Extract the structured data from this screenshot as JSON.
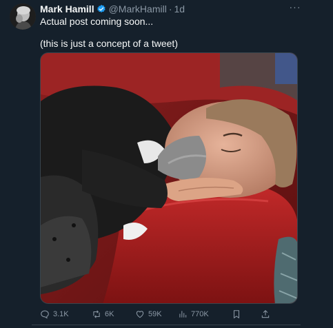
{
  "tweet": {
    "author_name": "Mark Hamill",
    "handle": "@MarkHamill",
    "separator": "·",
    "time": "1d",
    "text_line1": "Actual post coming soon...",
    "text_line2": "(this is just a concept of a tweet)",
    "more_label": "···"
  },
  "actions": {
    "replies": "3.1K",
    "retweets": "6K",
    "likes": "59K",
    "views": "770K"
  },
  "colors": {
    "background": "#15202b",
    "text": "#f7f9f9",
    "secondary_text": "#8b98a5",
    "verified": "#1d9bf0"
  },
  "icons": {
    "verified": "verified-badge-icon",
    "more": "more-dots-icon",
    "reply": "reply-icon",
    "retweet": "retweet-icon",
    "like": "heart-icon",
    "views": "views-chart-icon",
    "bookmark": "bookmark-icon",
    "share": "share-icon"
  }
}
